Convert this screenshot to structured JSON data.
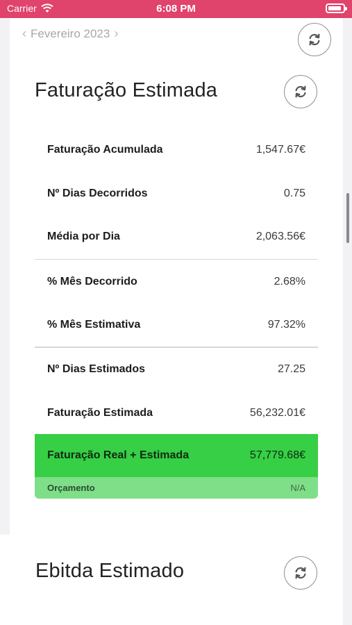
{
  "status_bar": {
    "carrier": "Carrier",
    "time": "6:08 PM"
  },
  "month_nav": {
    "label": "Fevereiro 2023"
  },
  "section1": {
    "title": "Faturação Estimada",
    "rows": [
      {
        "label": "Faturação Acumulada",
        "value": "1,547.67€"
      },
      {
        "label": "Nº Dias Decorridos",
        "value": "0.75"
      },
      {
        "label": "Média por Dia",
        "value": "2,063.56€"
      },
      {
        "label": "% Mês Decorrido",
        "value": "2.68%"
      },
      {
        "label": "% Mês Estimativa",
        "value": "97.32%"
      },
      {
        "label": "Nº Dias Estimados",
        "value": "27.25"
      },
      {
        "label": "Faturação Estimada",
        "value": "56,232.01€"
      }
    ],
    "highlight": {
      "label": "Faturação Real + Estimada",
      "value": "57,779.68€"
    },
    "budget": {
      "label": "Orçamento",
      "value": "N/A"
    }
  },
  "section2": {
    "title": "Ebitda Estimado"
  },
  "colors": {
    "status_bar": "#e0436b",
    "highlight": "#36cf45",
    "budget": "#7fdf88"
  },
  "icons": {
    "refresh": "refresh-icon",
    "prev": "chevron-left-icon",
    "next": "chevron-right-icon",
    "wifi": "wifi-icon",
    "battery": "battery-icon"
  }
}
